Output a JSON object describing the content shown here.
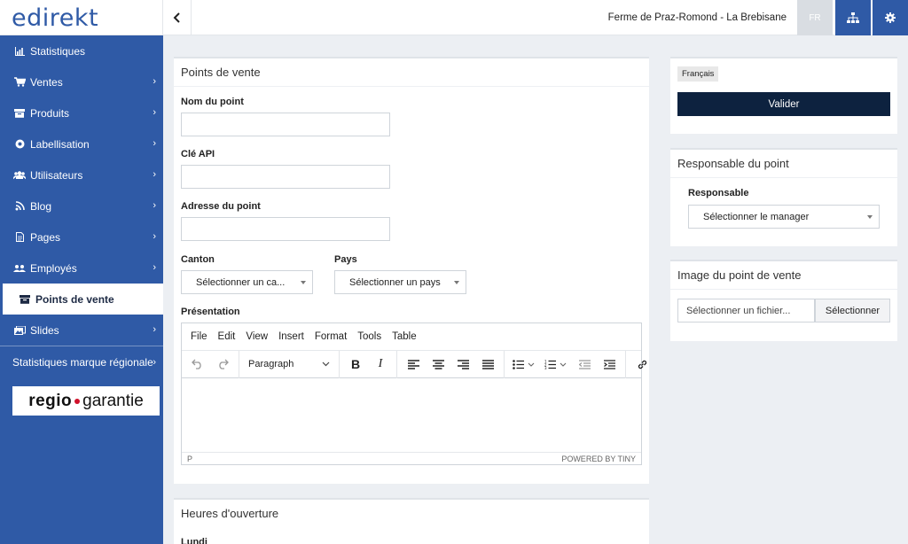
{
  "header": {
    "logo": "edirekt",
    "site_name": "Ferme de Praz-Romond - La Brebisane",
    "lang_button": "FR"
  },
  "sidebar": {
    "items": [
      {
        "label": "Statistiques",
        "icon": "chart-icon",
        "chevron": false
      },
      {
        "label": "Ventes",
        "icon": "cart-icon",
        "chevron": true
      },
      {
        "label": "Produits",
        "icon": "box-icon",
        "chevron": true
      },
      {
        "label": "Labellisation",
        "icon": "badge-icon",
        "chevron": true
      },
      {
        "label": "Utilisateurs",
        "icon": "users-icon",
        "chevron": true
      },
      {
        "label": "Blog",
        "icon": "blog-icon",
        "chevron": true
      },
      {
        "label": "Pages",
        "icon": "page-icon",
        "chevron": true
      },
      {
        "label": "Employés",
        "icon": "employees-icon",
        "chevron": true
      },
      {
        "label": "Points de vente",
        "icon": "store-icon",
        "chevron": false,
        "active": true
      },
      {
        "label": "Slides",
        "icon": "slides-icon",
        "chevron": true
      }
    ],
    "regional_stats": "Statistiques marque régionale",
    "regio_brand_left": "regio",
    "regio_brand_right": "garantie"
  },
  "main": {
    "panel_title": "Points de vente",
    "name_label": "Nom du point",
    "name_value": "",
    "api_label": "Clé API",
    "api_value": "",
    "address_label": "Adresse du point",
    "address_value": "",
    "canton_label": "Canton",
    "canton_select": "Sélectionner un ca...",
    "country_label": "Pays",
    "country_select": "Sélectionner un pays",
    "presentation_label": "Présentation",
    "editor": {
      "menu": [
        "File",
        "Edit",
        "View",
        "Insert",
        "Format",
        "Tools",
        "Table"
      ],
      "block_format": "Paragraph",
      "status_path": "P",
      "powered_by": "POWERED BY TINY"
    },
    "hours_title": "Heures d'ouverture",
    "hours_day": "Lundi"
  },
  "right": {
    "language_tag": "Français",
    "submit_label": "Valider",
    "manager_title": "Responsable du point",
    "manager_label": "Responsable",
    "manager_select": "Sélectionner le manager",
    "image_title": "Image du point de vente",
    "file_placeholder": "Sélectionner un fichier...",
    "file_button": "Sélectionner"
  },
  "colors": {
    "brand_blue": "#2f5aa6",
    "dark_button": "#0d223f",
    "background": "#eceff3"
  }
}
